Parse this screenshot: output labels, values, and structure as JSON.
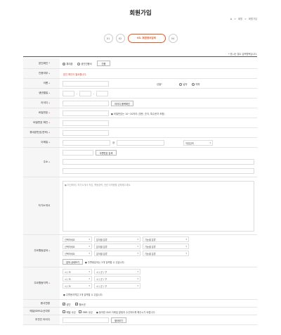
{
  "page_title": "회원가입",
  "breadcrumb": [
    "⌂",
    ">",
    "회원",
    ">",
    "회원가입"
  ],
  "steps": [
    "01",
    "02",
    "03. 회원정보입력",
    "04"
  ],
  "required_note": "* 표시는 필수 입력항목입니다.",
  "labels": {
    "identity": "본인확인",
    "auth_status": "인증여부",
    "name": "이름",
    "birth": "생년월일",
    "id": "아이디",
    "password": "비밀번호",
    "password_confirm": "비밀번호 확인",
    "phone": "휴대폰번호(연락)",
    "email": "이메일",
    "address": "주소",
    "intro": "자기소개서",
    "main_field": "주요활동분야",
    "main_region": "주요활동지역",
    "volunteer": "봉사연령",
    "sms_consent": "메일/SMS수신여부",
    "recommender": "추천인 아이디",
    "gender": "성별"
  },
  "identity": {
    "option1": "휴대폰",
    "option2": "공인인증서",
    "button": "인증"
  },
  "auth_status_text": "본인 확인이 필요합니다.",
  "gender": {
    "male": "남자",
    "female": "여자"
  },
  "birth_sep": "-",
  "id_check_button": "아이디 중복확인",
  "password_hint": "● 비밀번호는 10~20자리 (영문, 숫자, 특수문자 조합)",
  "email": {
    "at": "@",
    "domain_select": "직접입력"
  },
  "address_button": "우편번호 검색",
  "intro_placeholder": "● 자신에게 / 자기소개서 작성, 활동경력, 관련 자격증을 입력해주세요.",
  "field_selects": [
    [
      "선택하세요",
      "분야별 분류",
      "기능별 분류"
    ],
    [
      "선택하세요",
      "분야별 분류",
      "기능별 분류"
    ],
    [
      "선택하세요",
      "분야별 분류",
      "기능별 분류"
    ]
  ],
  "field_button": "분야 상세보기",
  "field_note": "● 주활동분야는 3개 입력할 수 있습니다.",
  "region_selects": [
    [
      "시 / 도",
      "시 / 군 / 구"
    ],
    [
      "시 / 도",
      "시 / 군 / 구"
    ],
    [
      "시 / 도",
      "시 / 군 / 구"
    ]
  ],
  "region_note": "● 주활동지역은 3개 입력할 수 있습니다.",
  "volunteer": {
    "opt1": "성인",
    "opt2": "청소년"
  },
  "sms": {
    "opt1": "메일 수신",
    "opt2": "SMS 수신",
    "note": "● 동의한 SNS 이메일 알림과 수신되도록 해주시기 바랍니다."
  },
  "recommender_button": "찾아보기"
}
